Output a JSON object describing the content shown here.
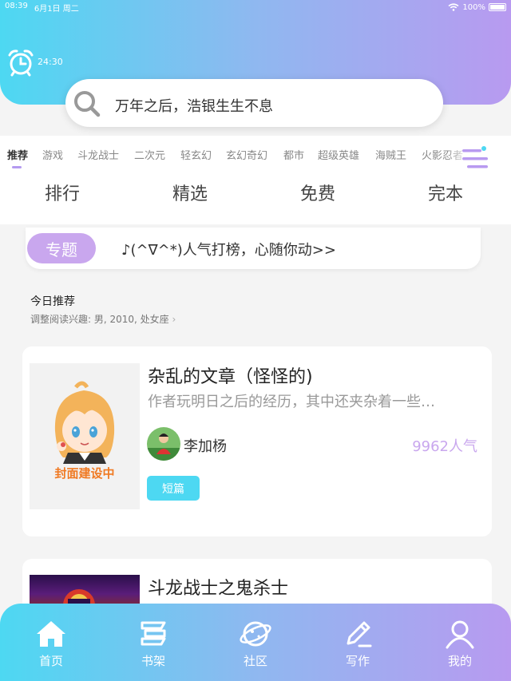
{
  "status_bar": {
    "time": "08:39",
    "date": "6月1日 周二",
    "battery": "100%"
  },
  "alarm": {
    "time": "24:30"
  },
  "search": {
    "placeholder": "万年之后，浩银生生不息"
  },
  "categories": [
    {
      "label": "推荐",
      "active": true
    },
    {
      "label": "游戏"
    },
    {
      "label": "斗龙战士"
    },
    {
      "label": "二次元"
    },
    {
      "label": "轻玄幻"
    },
    {
      "label": "玄幻奇幻"
    },
    {
      "label": "都市"
    },
    {
      "label": "超级英雄"
    },
    {
      "label": "海贼王"
    },
    {
      "label": "火影忍者"
    }
  ],
  "quick_links": [
    "排行",
    "精选",
    "免费",
    "完本"
  ],
  "topic": {
    "badge": "专题",
    "text": "♪(^∇^*)人气打榜，心随你动>>"
  },
  "section": {
    "title": "今日推荐",
    "subtitle": "调整阅读兴趣: 男, 2010, 处女座"
  },
  "books": [
    {
      "title": "杂乱的文章（怪怪的)",
      "description": "作者玩明日之后的经历，其中还夹杂着一些…",
      "author": "李加杨",
      "popularity": "9962人气",
      "tag": "短篇",
      "cover_label": "封面建设中"
    },
    {
      "title": "斗龙战士之鬼杀士"
    }
  ],
  "tabbar": [
    {
      "label": "首页",
      "icon": "home-icon"
    },
    {
      "label": "书架",
      "icon": "bookshelf-icon"
    },
    {
      "label": "社区",
      "icon": "planet-icon"
    },
    {
      "label": "写作",
      "icon": "pen-icon"
    },
    {
      "label": "我的",
      "icon": "profile-icon"
    }
  ],
  "colors": {
    "cyan": "#4dd8f2",
    "purple": "#b89af0",
    "lavender": "#c9a7ee",
    "orange": "#f07a23"
  }
}
